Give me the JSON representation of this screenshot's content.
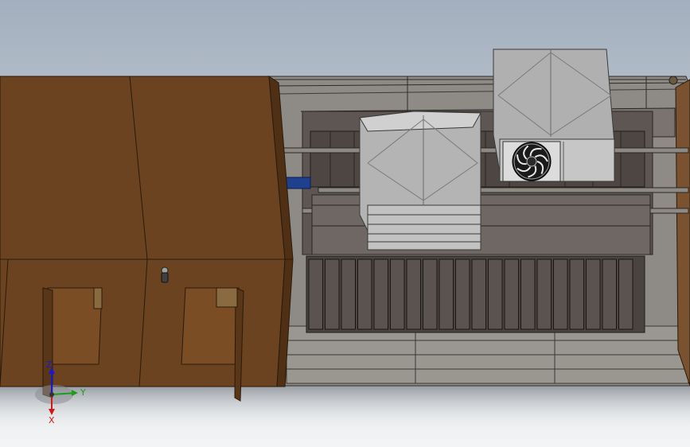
{
  "viewport": {
    "background_top": "#a5b0be",
    "background_bottom": "#f2f3f4"
  },
  "model": {
    "enclosure_color": "#6b4320",
    "enclosure_edge": "#2a1a0a",
    "frame_color": "#8a8580",
    "rack_color": "#5a5350",
    "cabinet_color": "#c4c4c4",
    "connector_color": "#1f3f8f",
    "fan_icon": "fan-icon"
  },
  "triad": {
    "x_label": "X",
    "y_label": "Y",
    "z_label": "Z",
    "x_color": "#d01818",
    "y_color": "#18a018",
    "z_color": "#1818d0"
  }
}
